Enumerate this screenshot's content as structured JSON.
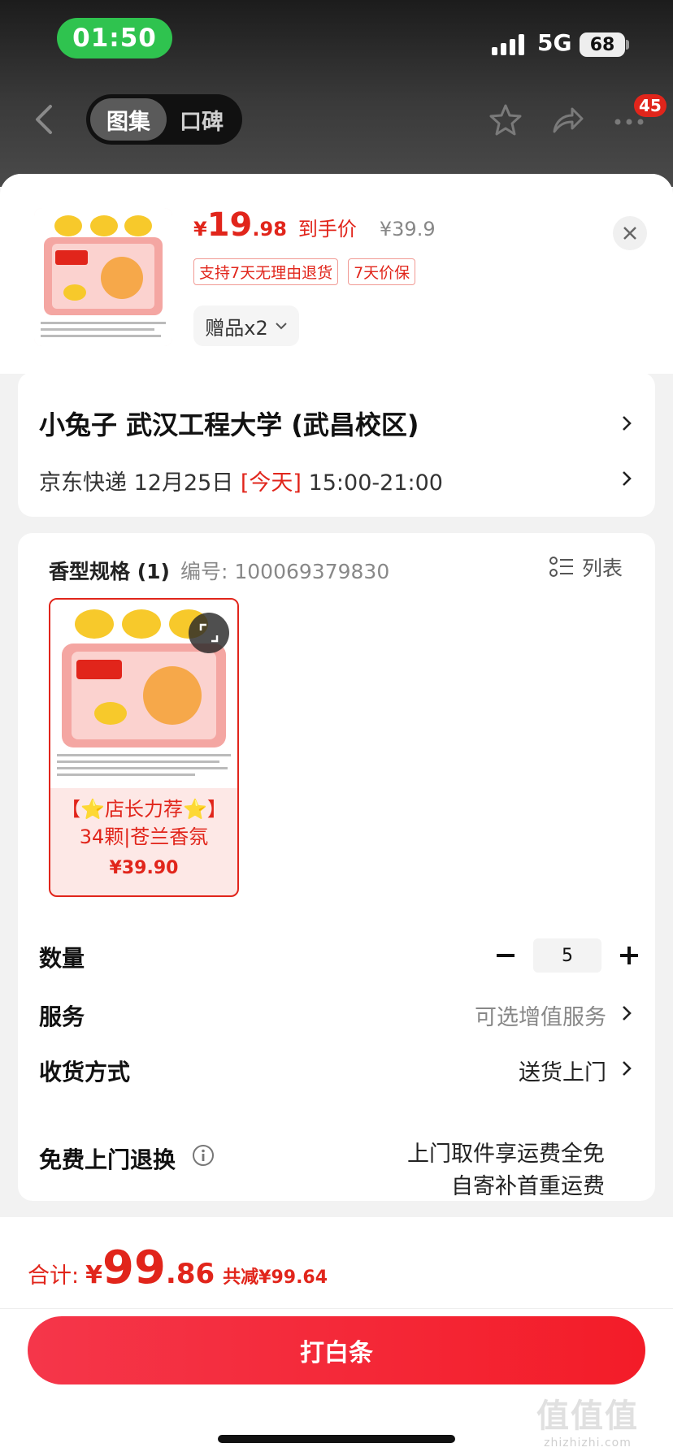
{
  "status_bar": {
    "time": "01:50",
    "network": "5G",
    "battery": "68"
  },
  "nav": {
    "tab_active": "图集",
    "tab_inactive": "口碑",
    "badge_count": "45"
  },
  "product": {
    "price_symbol": "¥",
    "price_int": "19",
    "price_dec": ".98",
    "price_label": "到手价",
    "original_price": "¥39.9",
    "tags": [
      "支持7天无理由退货",
      "7天价保"
    ],
    "gift_label": "赠品x2"
  },
  "address": {
    "name_line": "小兔子  武汉工程大学 (武昌校区)",
    "delivery_prefix": "京东快递 12月25日",
    "delivery_highlight": "[今天]",
    "delivery_time": "15:00-21:00"
  },
  "spec": {
    "title": "香型规格 (1)",
    "sku": "编号: 100069379830",
    "list_label": "列表",
    "option": {
      "line1": "【⭐店长力荐⭐】",
      "line2": "34颗|苍兰香氛",
      "price": "¥39.90"
    }
  },
  "rows": {
    "quantity_label": "数量",
    "quantity_value": "5",
    "service_label": "服务",
    "service_value": "可选增值服务",
    "delivery_method_label": "收货方式",
    "delivery_method_value": "送货上门",
    "return_label": "免费上门退换",
    "return_value_line1": "上门取件享运费全免",
    "return_value_line2": "自寄补首重运费"
  },
  "footer": {
    "total_label": "合计:",
    "total_symbol": "¥",
    "total_int": "99",
    "total_dec": ".86",
    "total_saving": "共减¥99.64",
    "pay_button": "打白条"
  },
  "watermark": {
    "big": "值值值",
    "small": "zhizhizhi.com"
  },
  "colors": {
    "accent": "#e1251b",
    "status_green": "#2fc34f"
  }
}
